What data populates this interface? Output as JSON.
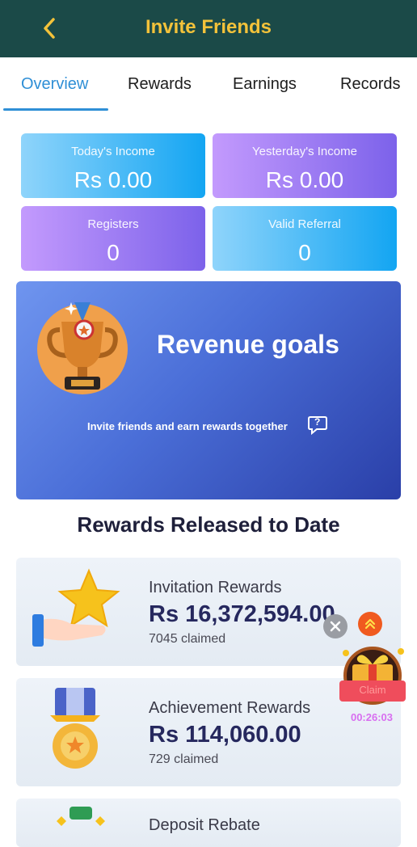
{
  "header": {
    "title": "Invite Friends"
  },
  "tabs": [
    {
      "label": "Overview"
    },
    {
      "label": "Rewards"
    },
    {
      "label": "Earnings"
    },
    {
      "label": "Records"
    }
  ],
  "stats": [
    {
      "label": "Today's Income",
      "value": "Rs  0.00"
    },
    {
      "label": "Yesterday's Income",
      "value": "Rs  0.00"
    },
    {
      "label": "Registers",
      "value": "0"
    },
    {
      "label": "Valid Referral",
      "value": "0"
    }
  ],
  "banner": {
    "title": "Revenue goals",
    "subtitle": "Invite friends and earn rewards together",
    "help_symbol": "?"
  },
  "section": {
    "title": "Rewards Released to Date"
  },
  "rewards": [
    {
      "name": "Invitation Rewards",
      "amount": "Rs  16,372,594.00",
      "claimed": "7045 claimed"
    },
    {
      "name": "Achievement Rewards",
      "amount": "Rs  114,060.00",
      "claimed": "729 claimed"
    },
    {
      "name": "Deposit Rebate",
      "amount": "",
      "claimed": ""
    }
  ],
  "floating": {
    "claim_label": "Claim",
    "timer": "00:26:03"
  },
  "colors": {
    "header_bg": "#1b4a48",
    "title": "#f3c23a",
    "accent": "#2f8fd6"
  },
  "icons": [
    "back-chevron-icon",
    "trophy-icon",
    "help-icon",
    "star-hand-icon",
    "medal-icon",
    "close-icon",
    "double-chevron-up-icon",
    "gift-icon"
  ]
}
